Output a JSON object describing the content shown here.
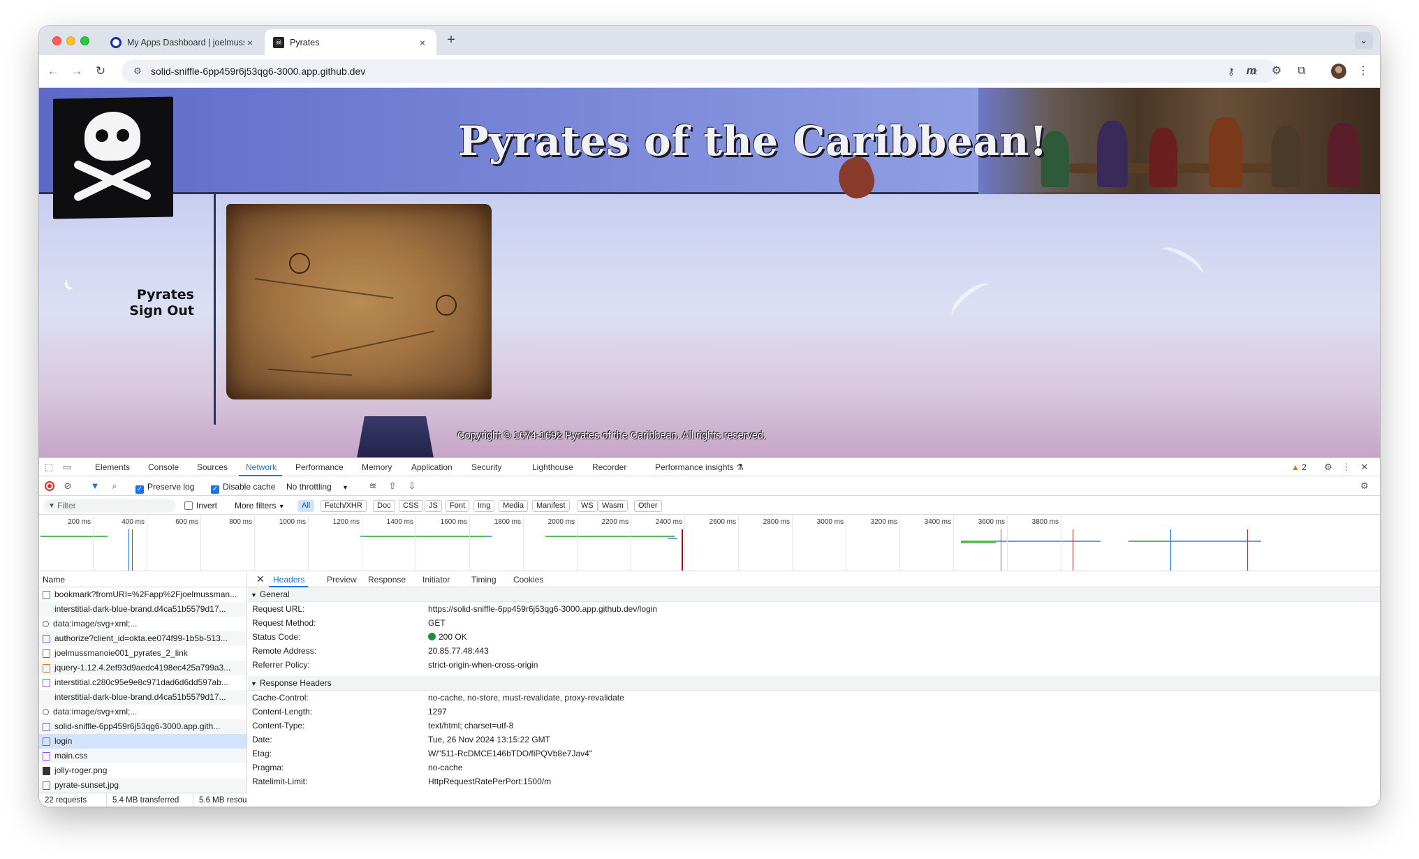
{
  "browser": {
    "tabs": [
      {
        "title": "My Apps Dashboard | joelmuss",
        "active": false
      },
      {
        "title": "Pyrates",
        "active": true
      }
    ],
    "url": "solid-sniffle-6pp459r6j53qg6-3000.app.github.dev"
  },
  "site": {
    "title": "Pyrates of the Caribbean!",
    "nav": [
      "Pyrates",
      "Sign Out"
    ],
    "copyright": "Copyright © 1674-1692 Pyrates of the Caribbean. All rights reserved."
  },
  "devtools": {
    "tabs": [
      "Elements",
      "Console",
      "Sources",
      "Network",
      "Performance",
      "Memory",
      "Application",
      "Security",
      "Lighthouse",
      "Recorder",
      "Performance insights"
    ],
    "active_tab": "Network",
    "warnings_count": "2",
    "toolbar": {
      "preserve_log": "Preserve log",
      "disable_cache": "Disable cache",
      "throttling": "No throttling"
    },
    "filter": {
      "placeholder": "Filter",
      "invert": "Invert",
      "more_filters": "More filters",
      "types": [
        "All",
        "Fetch/XHR",
        "Doc",
        "CSS",
        "JS",
        "Font",
        "Img",
        "Media",
        "Manifest",
        "WS",
        "Wasm",
        "Other"
      ],
      "selected_type": "All"
    },
    "timeline_ticks": [
      "200 ms",
      "400 ms",
      "600 ms",
      "800 ms",
      "1000 ms",
      "1200 ms",
      "1400 ms",
      "1600 ms",
      "1800 ms",
      "2000 ms",
      "2200 ms",
      "2400 ms",
      "2600 ms",
      "2800 ms",
      "3000 ms",
      "3200 ms",
      "3400 ms",
      "3600 ms",
      "3800 ms"
    ],
    "request_list": {
      "header": "Name",
      "rows": [
        {
          "name": "bookmark?fromURI=%2Fapp%2Fjoelmussman...",
          "type": "doc"
        },
        {
          "name": "interstitial-dark-blue-brand.d4ca51b5579d17...",
          "type": "none"
        },
        {
          "name": "data:image/svg+xml;...",
          "type": "img"
        },
        {
          "name": "authorize?client_id=okta.ee074f99-1b5b-513...",
          "type": "doc"
        },
        {
          "name": "joelmussmanoie001_pyrates_2_link",
          "type": "doc"
        },
        {
          "name": "jquery-1.12.4.2ef93d9aedc4198ec425a799a3...",
          "type": "js"
        },
        {
          "name": "interstitial.c280c95e9e8c971dad6d6dd597ab...",
          "type": "css"
        },
        {
          "name": "interstitial-dark-blue-brand.d4ca51b5579d17...",
          "type": "none"
        },
        {
          "name": "data:image/svg+xml;...",
          "type": "img"
        },
        {
          "name": "solid-sniffle-6pp459r6j53qg6-3000.app.gith...",
          "type": "doc"
        },
        {
          "name": "login",
          "type": "doc",
          "selected": true
        },
        {
          "name": "main.css",
          "type": "css"
        },
        {
          "name": "jolly-roger.png",
          "type": "jpg"
        },
        {
          "name": "pyrate-sunset.jpg",
          "type": "doc"
        }
      ],
      "summary": {
        "requests": "22 requests",
        "transferred": "5.4 MB transferred",
        "resources": "5.6 MB resou"
      }
    },
    "details": {
      "tabs": [
        "Headers",
        "Preview",
        "Response",
        "Initiator",
        "Timing",
        "Cookies"
      ],
      "active_tab": "Headers",
      "general_title": "General",
      "general": [
        {
          "key": "Request URL:",
          "value": "https://solid-sniffle-6pp459r6j53qg6-3000.app.github.dev/login"
        },
        {
          "key": "Request Method:",
          "value": "GET"
        },
        {
          "key": "Status Code:",
          "value": "200 OK"
        },
        {
          "key": "Remote Address:",
          "value": "20.85.77.48:443"
        },
        {
          "key": "Referrer Policy:",
          "value": "strict-origin-when-cross-origin"
        }
      ],
      "response_title": "Response Headers",
      "response_headers": [
        {
          "key": "Cache-Control:",
          "value": "no-cache, no-store, must-revalidate, proxy-revalidate"
        },
        {
          "key": "Content-Length:",
          "value": "1297"
        },
        {
          "key": "Content-Type:",
          "value": "text/html; charset=utf-8"
        },
        {
          "key": "Date:",
          "value": "Tue, 26 Nov 2024 13:15:22 GMT"
        },
        {
          "key": "Etag:",
          "value": "W/\"511-RcDMCE146bTDO/fiPQVb8e7Jav4\""
        },
        {
          "key": "Pragma:",
          "value": "no-cache"
        },
        {
          "key": "Ratelimit-Limit:",
          "value": "HttpRequestRatePerPort:1500/m"
        }
      ]
    }
  }
}
